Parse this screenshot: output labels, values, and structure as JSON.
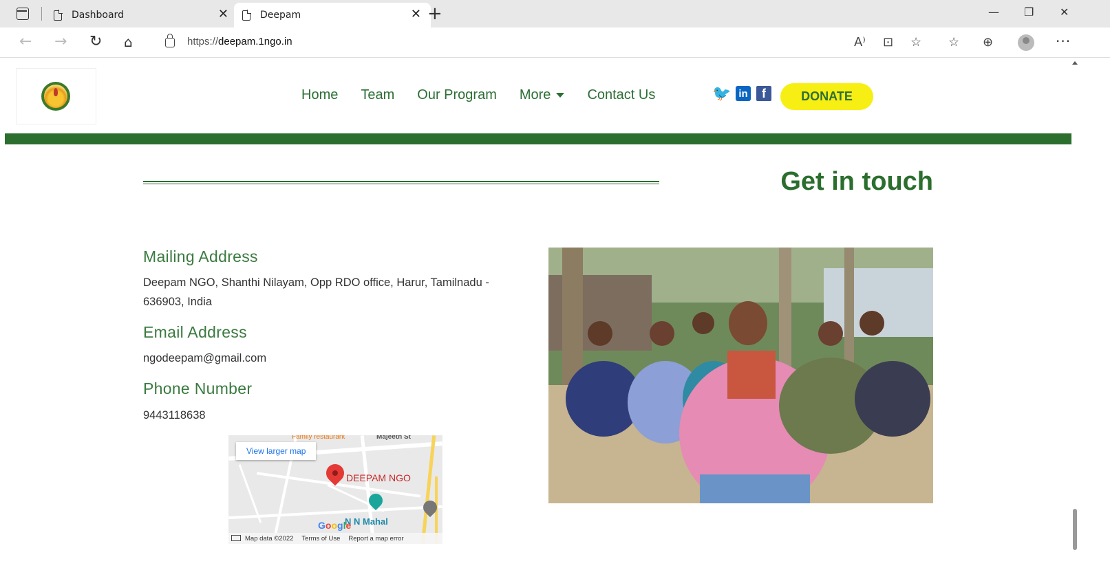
{
  "browser": {
    "tabs": [
      {
        "label": "Dashboard",
        "close": "✕"
      },
      {
        "label": "Deepam",
        "close": "✕"
      }
    ],
    "new_tab": "+",
    "window_controls": {
      "minimize": "—",
      "restore": "❐",
      "close": "✕"
    },
    "address": {
      "protocol": "https://",
      "host": "deepam.1ngo.in"
    },
    "icons": [
      "back-icon",
      "forward-icon",
      "refresh-icon",
      "home-icon",
      "lock-icon",
      "read-aloud-icon",
      "immersive-reader-icon",
      "add-favorite-icon",
      "favorites-icon",
      "collections-icon",
      "profile-icon",
      "more-icon"
    ]
  },
  "site": {
    "nav": {
      "home": "Home",
      "team": "Team",
      "program": "Our Program",
      "more": "More",
      "contact": "Contact Us"
    },
    "donate": "DONATE",
    "band_color": "#2b6e2e",
    "donate_color": "#f7ef13"
  },
  "contact": {
    "heading": "Get in touch",
    "mailing_title": "Mailing Address",
    "mailing_text": "Deepam NGO, Shanthi Nilayam, Opp RDO office, Harur, Tamilnadu - 636903, India",
    "email_title": "Email Address",
    "email_text": "ngodeepam@gmail.com",
    "phone_title": "Phone Number",
    "phone_text": "9443118638"
  },
  "map": {
    "view_larger": "View larger map",
    "pin_label": "DEEPAM NGO",
    "family_restaurant": "Family restaurant",
    "majeeth": "Majeeth St",
    "n_mahal": "N N Mahal",
    "google": [
      "G",
      "o",
      "o",
      "g",
      "l",
      "e"
    ],
    "footer_data": "Map data ©2022",
    "footer_terms": "Terms of Use",
    "footer_report": "Report a map error"
  }
}
